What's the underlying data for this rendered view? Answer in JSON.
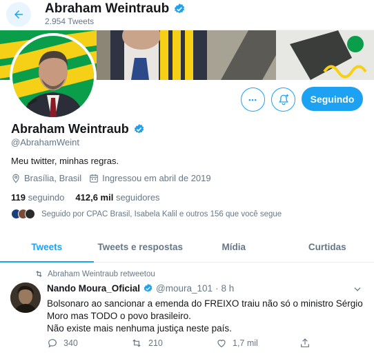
{
  "header": {
    "name": "Abraham Weintraub",
    "tweet_count": "2.954 Tweets"
  },
  "profile": {
    "name": "Abraham Weintraub",
    "handle": "@AbrahamWeint",
    "bio": "Meu twitter, minhas regras.",
    "location": "Brasília, Brasil",
    "joined": "Ingressou em abril de 2019",
    "following_count": "119",
    "following_label": "seguindo",
    "followers_count": "412,6 mil",
    "followers_label": "seguidores",
    "followed_by": "Seguido por CPAC Brasil, Isabela Kalil e outros 156 que você segue",
    "follow_button": "Seguindo",
    "more_button": "•••"
  },
  "tabs": [
    {
      "label": "Tweets"
    },
    {
      "label": "Tweets e respostas"
    },
    {
      "label": "Mídia"
    },
    {
      "label": "Curtidas"
    }
  ],
  "tweet": {
    "retweet_label": "Abraham Weintraub retweetou",
    "author_name": "Nando Moura_Oficial",
    "author_handle": "@moura_101",
    "separator": "·",
    "time": "8 h",
    "lines": [
      "Bolsonaro ao sancionar a emenda do FREIXO traiu não só o ministro Sérgio",
      "Moro mas TODO o povo brasileiro.",
      "Não existe mais nenhuma justiça neste país."
    ],
    "replies": "340",
    "retweets": "210",
    "likes": "1,7 mil"
  },
  "colors": {
    "accent": "#1da1f2",
    "muted": "#657786",
    "text": "#14171a",
    "banner_green": "#0a9d4a",
    "banner_yellow": "#f6cf17"
  },
  "icons": {
    "back": "arrow-left-icon",
    "verified": "verified-badge-icon",
    "notify": "bell-plus-icon",
    "location": "map-pin-icon",
    "calendar": "calendar-icon",
    "retweet": "retweet-icon",
    "reply": "reply-icon",
    "like": "heart-icon",
    "share": "share-icon",
    "caret": "chevron-down-icon"
  }
}
